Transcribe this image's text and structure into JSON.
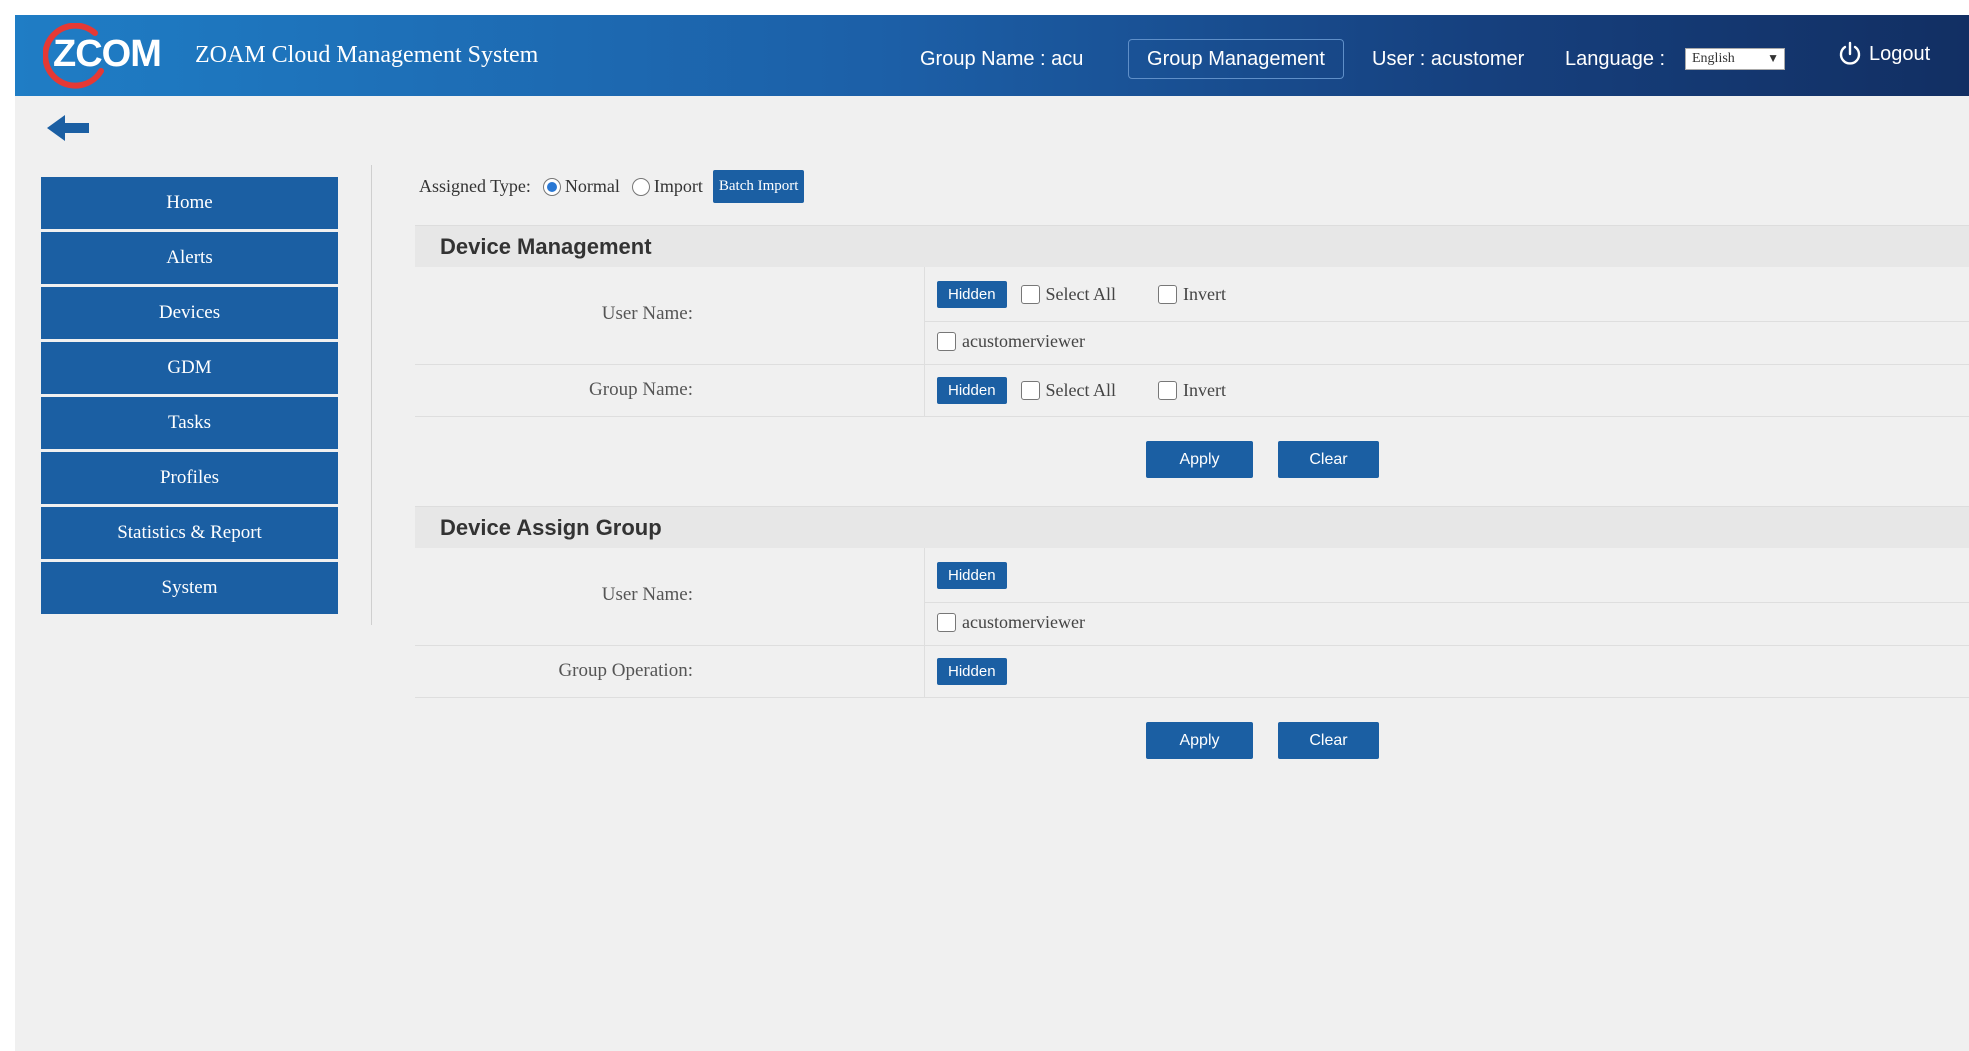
{
  "header": {
    "logo_text": "ZCOM",
    "title": "ZOAM Cloud Management System",
    "group_name": "Group Name : acu",
    "group_management": "Group Management",
    "user": "User : acustomer",
    "language_label": "Language :",
    "language_value": "English",
    "logout": "Logout"
  },
  "sidebar": {
    "items": [
      {
        "label": "Home"
      },
      {
        "label": "Alerts"
      },
      {
        "label": "Devices"
      },
      {
        "label": "GDM"
      },
      {
        "label": "Tasks"
      },
      {
        "label": "Profiles"
      },
      {
        "label": "Statistics & Report"
      },
      {
        "label": "System"
      }
    ]
  },
  "assigned": {
    "label": "Assigned Type:",
    "normal": "Normal",
    "import": "Import",
    "selected": "Normal",
    "batch_import": "Batch Import"
  },
  "device_management": {
    "title": "Device Management",
    "user_name_label": "User Name:",
    "group_name_label": "Group Name:",
    "hidden": "Hidden",
    "select_all": "Select All",
    "invert": "Invert",
    "user_option": "acustomerviewer",
    "apply": "Apply",
    "clear": "Clear"
  },
  "device_assign_group": {
    "title": "Device Assign Group",
    "user_name_label": "User Name:",
    "group_operation_label": "Group Operation:",
    "hidden": "Hidden",
    "user_option": "acustomerviewer",
    "apply": "Apply",
    "clear": "Clear"
  },
  "colors": {
    "primary": "#1b5fa3",
    "header_dark": "#122f63",
    "logo_ring": "#e53935"
  }
}
